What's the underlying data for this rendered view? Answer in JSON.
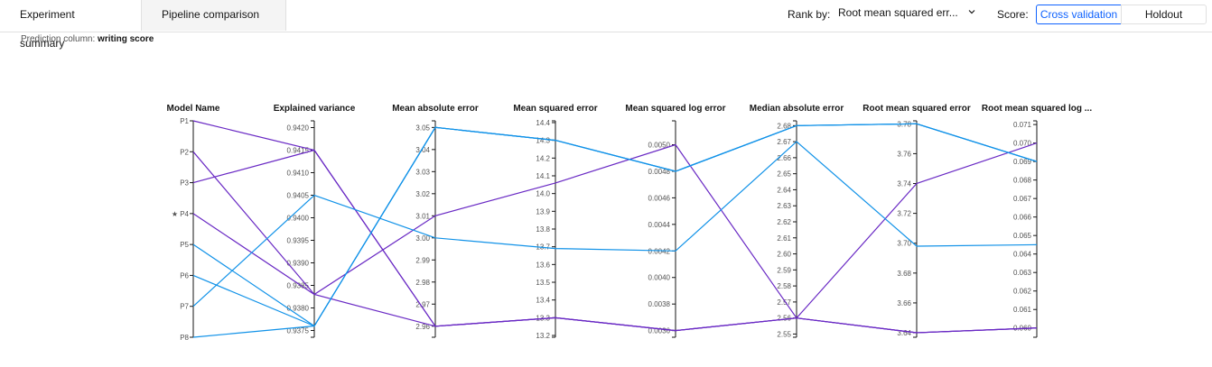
{
  "tabs": [
    {
      "label": "Experiment summary"
    },
    {
      "label": "Pipeline comparison"
    }
  ],
  "controls": {
    "rank_label": "Rank by:",
    "rank_value": "Root mean squared err...",
    "score_label": "Score:",
    "score_options": [
      "Cross validation",
      "Holdout"
    ],
    "score_selected": "Cross validation"
  },
  "prediction": {
    "label": "Prediction column:",
    "value": "writing score"
  },
  "colors": {
    "purple": "#6929c4",
    "blue": "#1192e8",
    "accent": "#0f62fe",
    "axis": "#161616"
  },
  "chart_data": {
    "type": "parallel_coordinates",
    "model_axis": {
      "title": "Model Name",
      "labels": [
        "P1",
        "P2",
        "P3",
        "P4",
        "P5",
        "P6",
        "P7",
        "P8"
      ],
      "star": "P4"
    },
    "axes": [
      {
        "title": "Explained variance",
        "min": 0.93735,
        "max": 0.94215,
        "ticks": [
          0.9375,
          0.938,
          0.9385,
          0.939,
          0.9395,
          0.94,
          0.9405,
          0.941,
          0.9415,
          0.942
        ],
        "tick_labels": [
          "0.9375",
          "0.9380",
          "0.9385",
          "0.9390",
          "0.9395",
          "0.9400",
          "0.9405",
          "0.9410",
          "0.9415",
          "0.9420"
        ]
      },
      {
        "title": "Mean absolute error",
        "min": 2.955,
        "max": 3.053,
        "ticks": [
          2.96,
          2.97,
          2.98,
          2.99,
          3.0,
          3.01,
          3.02,
          3.03,
          3.04,
          3.05
        ],
        "tick_labels": [
          "2.96",
          "2.97",
          "2.98",
          "2.99",
          "3.00",
          "3.01",
          "3.02",
          "3.03",
          "3.04",
          "3.05"
        ]
      },
      {
        "title": "Mean squared error",
        "min": 13.19,
        "max": 14.41,
        "ticks": [
          13.2,
          13.3,
          13.4,
          13.5,
          13.6,
          13.7,
          13.8,
          13.9,
          14.0,
          14.1,
          14.2,
          14.3,
          14.4
        ],
        "tick_labels": [
          "13.2",
          "13.3",
          "13.4",
          "13.5",
          "13.6",
          "13.7",
          "13.8",
          "13.9",
          "14.0",
          "14.1",
          "14.2",
          "14.3",
          "14.4"
        ]
      },
      {
        "title": "Mean squared log error",
        "min": 0.00355,
        "max": 0.00518,
        "ticks": [
          0.0036,
          0.0038,
          0.004,
          0.0042,
          0.0044,
          0.0046,
          0.0048,
          0.005
        ],
        "tick_labels": [
          "0.0036",
          "0.0038",
          "0.0040",
          "0.0042",
          "0.0044",
          "0.0046",
          "0.0048",
          "0.0050"
        ]
      },
      {
        "title": "Median absolute error",
        "min": 2.548,
        "max": 2.683,
        "ticks": [
          2.55,
          2.56,
          2.57,
          2.58,
          2.59,
          2.6,
          2.61,
          2.62,
          2.63,
          2.64,
          2.65,
          2.66,
          2.67,
          2.68
        ],
        "tick_labels": [
          "2.55",
          "2.56",
          "2.57",
          "2.58",
          "2.59",
          "2.60",
          "2.61",
          "2.62",
          "2.63",
          "2.64",
          "2.65",
          "2.66",
          "2.67",
          "2.68"
        ]
      },
      {
        "title": "Root mean squared error",
        "min": 3.637,
        "max": 3.782,
        "ticks": [
          3.64,
          3.66,
          3.68,
          3.7,
          3.72,
          3.74,
          3.76,
          3.78
        ],
        "tick_labels": [
          "3.64",
          "3.66",
          "3.68",
          "3.70",
          "3.72",
          "3.74",
          "3.76",
          "3.78"
        ]
      },
      {
        "title": "Root mean squared log ...",
        "min": 0.0595,
        "max": 0.0712,
        "ticks": [
          0.06,
          0.061,
          0.062,
          0.063,
          0.064,
          0.065,
          0.066,
          0.067,
          0.068,
          0.069,
          0.07,
          0.071
        ],
        "tick_labels": [
          "0.060",
          "0.061",
          "0.062",
          "0.063",
          "0.064",
          "0.065",
          "0.066",
          "0.067",
          "0.068",
          "0.069",
          "0.070",
          "0.071"
        ]
      }
    ],
    "series": [
      {
        "model": "P1",
        "color": "purple",
        "values": [
          0.9415,
          2.96,
          13.3,
          0.0036,
          2.56,
          3.64,
          0.06
        ]
      },
      {
        "model": "P2",
        "color": "purple",
        "values": [
          0.9383,
          2.96,
          13.3,
          0.0036,
          2.56,
          3.64,
          0.06
        ]
      },
      {
        "model": "P3",
        "color": "purple",
        "values": [
          0.9415,
          2.96,
          13.3,
          0.0036,
          2.56,
          3.64,
          0.06
        ]
      },
      {
        "model": "P4",
        "color": "purple",
        "values": [
          0.9383,
          3.01,
          14.06,
          0.005,
          2.56,
          3.74,
          0.07
        ]
      },
      {
        "model": "P5",
        "color": "blue",
        "values": [
          0.9376,
          3.05,
          14.3,
          0.0048,
          2.68,
          3.78,
          0.069
        ]
      },
      {
        "model": "P6",
        "color": "blue",
        "values": [
          0.9376,
          3.05,
          14.3,
          0.0048,
          2.68,
          3.78,
          0.069
        ]
      },
      {
        "model": "P7",
        "color": "blue",
        "values": [
          0.9405,
          3.0,
          13.69,
          0.0042,
          2.67,
          3.698,
          0.0645
        ]
      },
      {
        "model": "P8",
        "color": "blue",
        "values": [
          0.9376,
          3.05,
          14.3,
          0.0048,
          2.68,
          3.78,
          0.069
        ]
      }
    ]
  }
}
